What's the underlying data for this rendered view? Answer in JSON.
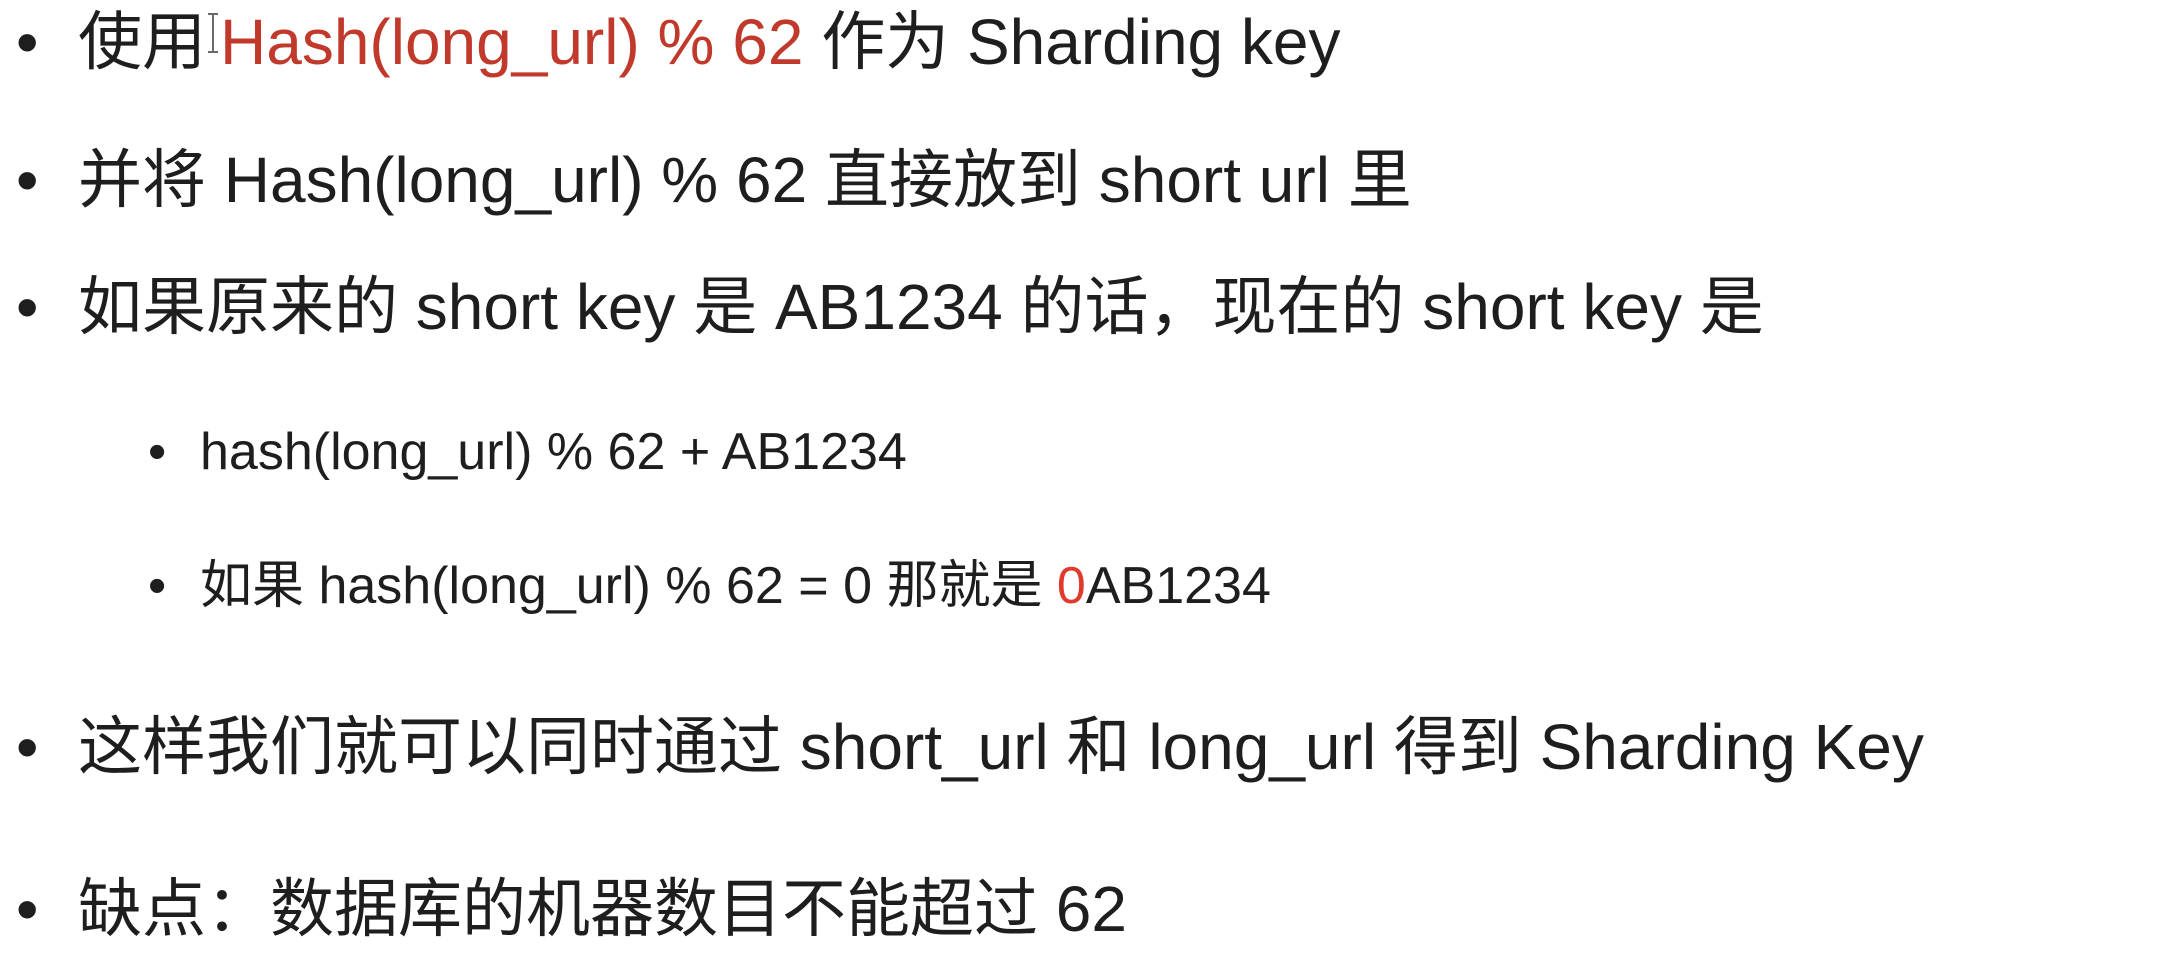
{
  "bullets": {
    "b1": {
      "prefix": "使用",
      "highlight": "Hash(long_url) % 62",
      "suffix": " 作为 Sharding key"
    },
    "b2": {
      "text": "并将 Hash(long_url) % 62 直接放到 short url 里"
    },
    "b3": {
      "text": "如果原来的 short key 是 AB1234 的话，现在的 short key 是"
    },
    "b3_sub1": {
      "text": "hash(long_url) % 62 + AB1234"
    },
    "b3_sub2": {
      "prefix": "如果 hash(long_url) % 62 = 0 那就是 ",
      "highlight": "0",
      "suffix": "AB1234"
    },
    "b4": {
      "text": "这样我们就可以同时通过 short_url 和 long_url 得到 Sharding Key"
    },
    "b5": {
      "text": "缺点：数据库的机器数目不能超过 62"
    }
  },
  "bullet_symbol": "•",
  "colors": {
    "text": "#1e1e1e",
    "highlight": "#c0392b",
    "highlight_bright": "#e03a2c"
  }
}
